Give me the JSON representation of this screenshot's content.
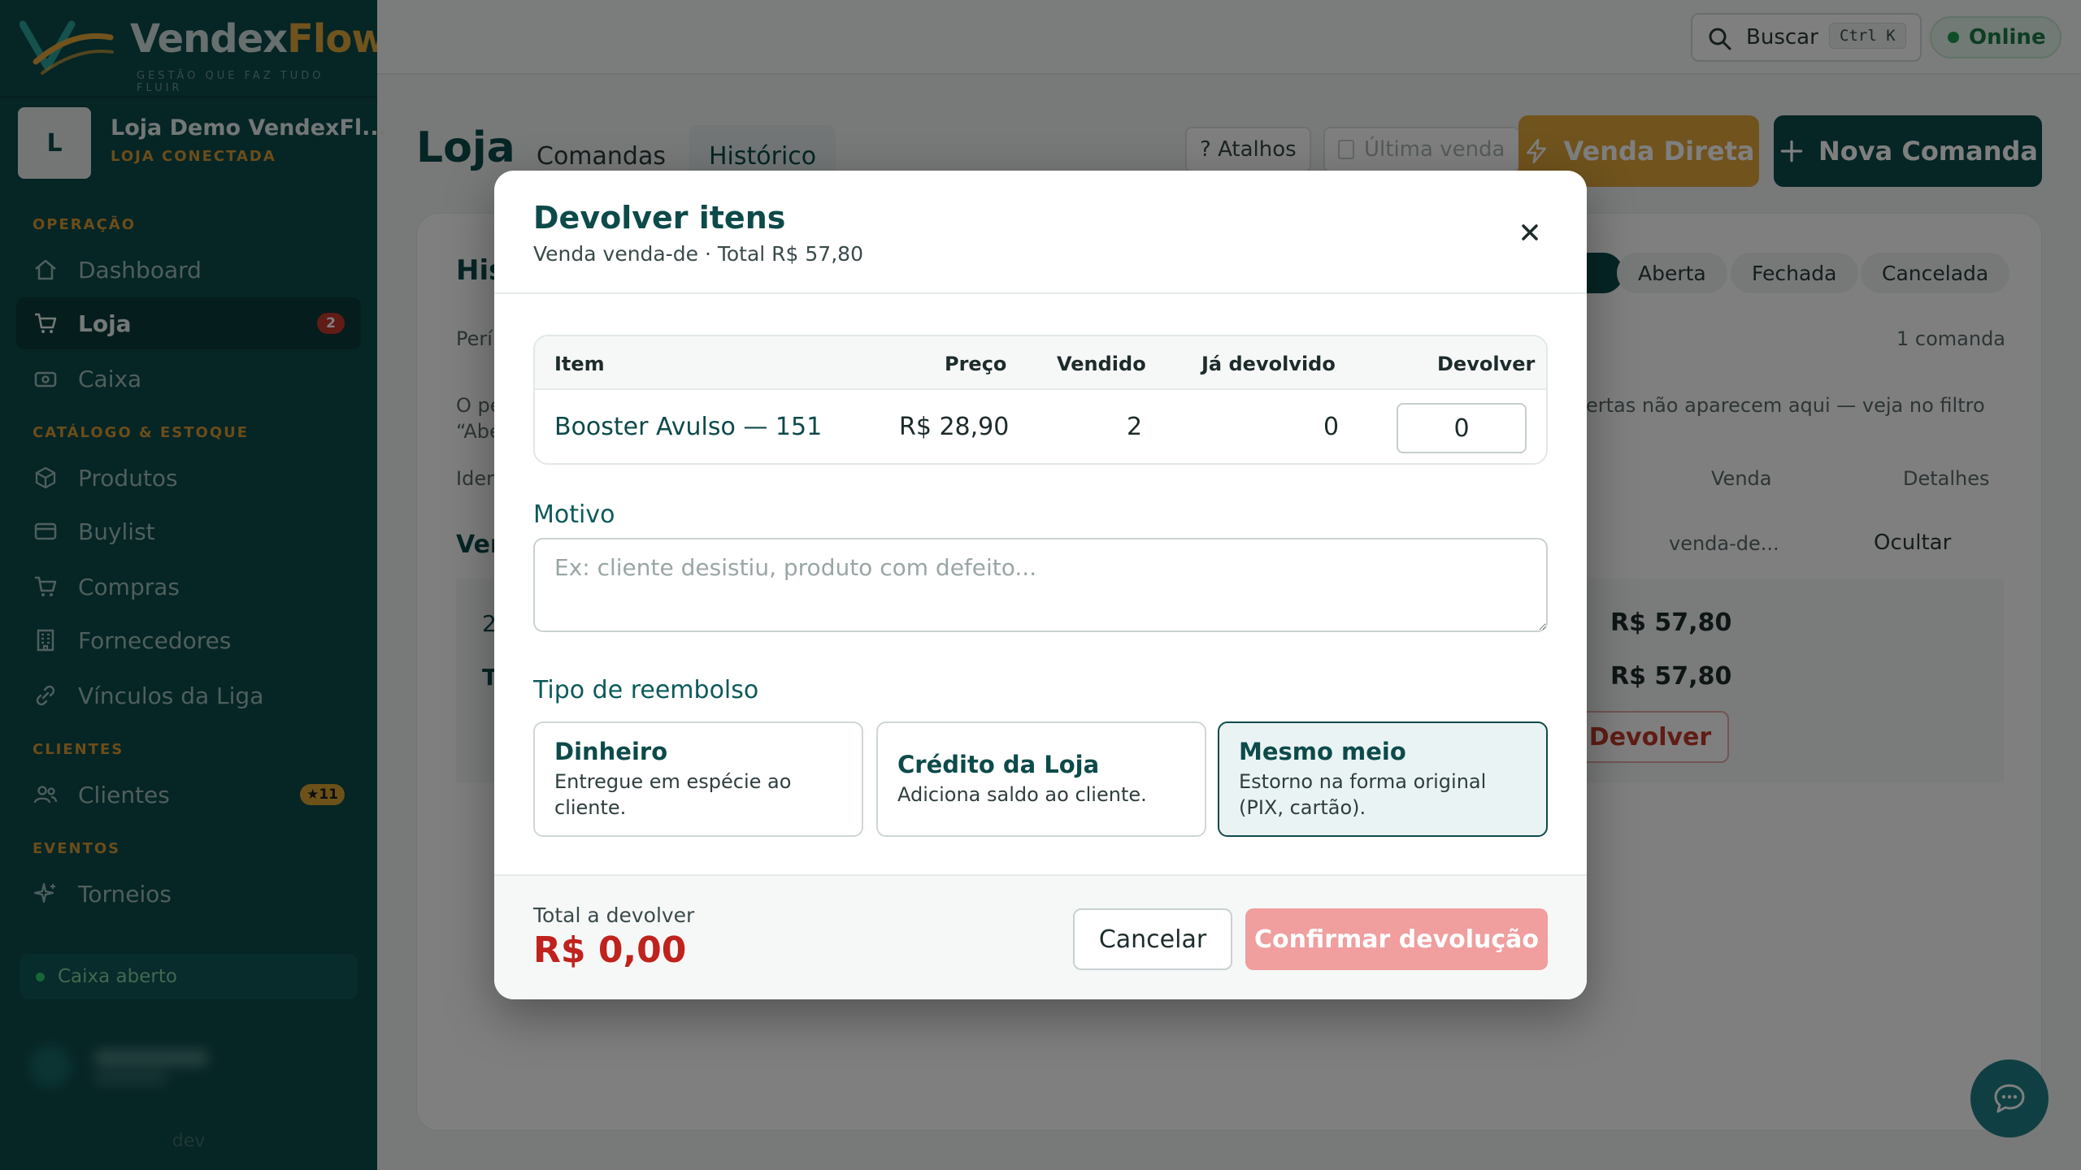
{
  "brand": {
    "name_a": "Vendex",
    "name_b": "Flow",
    "tagline": "GESTÃO QUE FAZ TUDO FLUIR"
  },
  "store": {
    "initial": "L",
    "name": "Loja Demo VendexFl...",
    "status": "LOJA CONECTADA"
  },
  "sidebar": {
    "sections": {
      "operacao": "OPERAÇÃO",
      "catalogo": "CATÁLOGO & ESTOQUE",
      "clientes": "CLIENTES",
      "eventos": "EVENTOS"
    },
    "items": {
      "dashboard": "Dashboard",
      "loja": "Loja",
      "loja_badge": "2",
      "caixa": "Caixa",
      "produtos": "Produtos",
      "buylist": "Buylist",
      "compras": "Compras",
      "fornecedores": "Fornecedores",
      "vinculos": "Vínculos da Liga",
      "clientes": "Clientes",
      "clientes_badge": "★11",
      "torneios": "Torneios"
    },
    "cash_status": "Caixa aberto",
    "env": "dev"
  },
  "topbar": {
    "search_label": "Buscar",
    "search_shortcut": "Ctrl K",
    "status": "Online"
  },
  "page": {
    "title": "Loja",
    "tabs": {
      "comandas": "Comandas",
      "historico": "Histórico"
    },
    "shortcuts": "? Atalhos",
    "last_sale": "Última venda",
    "direct_sale": "Venda Direta",
    "new_order": "Nova Comanda"
  },
  "history": {
    "title_partial": "His",
    "filters": {
      "all_partial": "s",
      "open": "Aberta",
      "closed": "Fechada",
      "cancelled": "Cancelada"
    },
    "period_partial": "Perí",
    "count": "1 comanda",
    "note_partial_left": "O pe",
    "note_partial_left2": "“Abe",
    "note_partial_right": "ertas não aparecem aqui — veja no filtro",
    "col_id_partial": "Ider",
    "col_sale": "Venda",
    "col_details": "Detalhes",
    "row_partial": "Ver",
    "row_sale_id": "venda-de...",
    "row_hide": "Ocultar",
    "sub_row_a_partial": "2",
    "sub_row_b_partial": "T",
    "amount_1": "R$ 57,80",
    "amount_2": "R$ 57,80",
    "return_button": "Devolver"
  },
  "modal": {
    "title": "Devolver itens",
    "subtitle": "Venda venda-de · Total R$ 57,80",
    "table": {
      "headers": {
        "item": "Item",
        "price": "Preço",
        "sold": "Vendido",
        "returned": "Já devolvido",
        "return": "Devolver"
      },
      "rows": [
        {
          "item": "Booster Avulso — 151",
          "price": "R$ 28,90",
          "sold": "2",
          "returned": "0",
          "return_qty": "0"
        }
      ]
    },
    "reason_label": "Motivo",
    "reason_placeholder": "Ex: cliente desistiu, produto com defeito...",
    "refund_label": "Tipo de reembolso",
    "refund_options": [
      {
        "title": "Dinheiro",
        "desc": "Entregue em espécie ao cliente."
      },
      {
        "title": "Crédito da Loja",
        "desc": "Adiciona saldo ao cliente."
      },
      {
        "title": "Mesmo meio",
        "desc": "Estorno na forma original (PIX, cartão)."
      }
    ],
    "selected_refund": "Mesmo meio",
    "total_label": "Total a devolver",
    "total_value": "R$ 0,00",
    "cancel": "Cancelar",
    "confirm": "Confirmar devolução"
  },
  "colors": {
    "primary": "#0d4a4a",
    "accent": "#e1a73a",
    "danger": "#c0221d",
    "success": "#1f9d55"
  }
}
